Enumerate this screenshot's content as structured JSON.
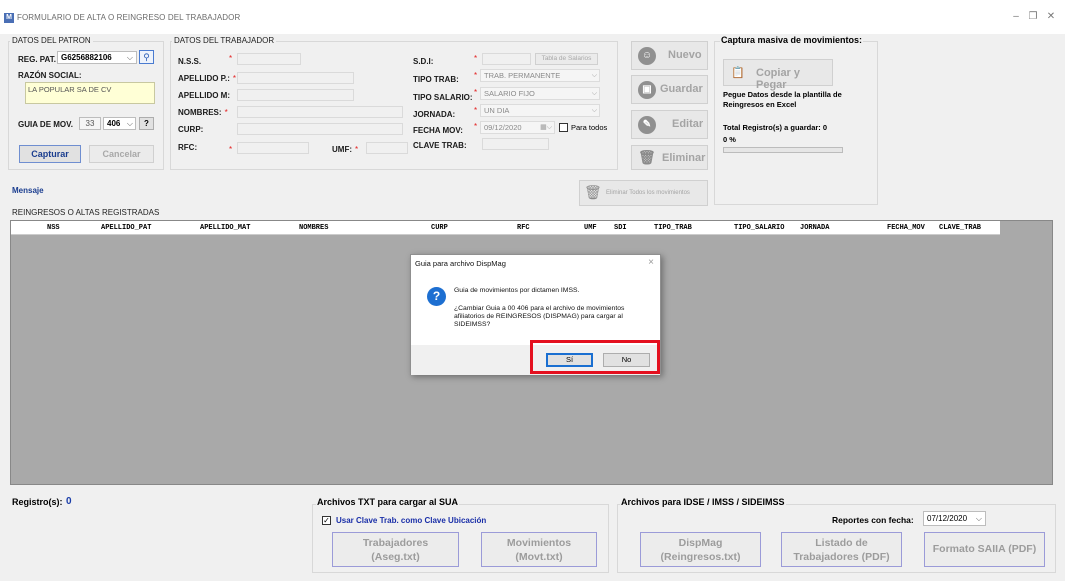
{
  "window": {
    "title": "FORMULARIO DE ALTA O REINGRESO DEL TRABAJADOR",
    "icon_letter": "M",
    "min": "–",
    "max": "❐",
    "close": "✕"
  },
  "patron": {
    "group_label": "DATOS DEL PATRON",
    "reg_pat_label": "REG. PAT.",
    "reg_pat_value": "G6256882106",
    "razon_label": "RAZÓN SOCIAL:",
    "razon_value": "LA POPULAR SA DE CV",
    "guia_label": "GUIA DE MOV.",
    "guia_num": "33",
    "guia_code": "406",
    "help": "?",
    "capturar": "Capturar",
    "cancelar": "Cancelar"
  },
  "trabajador": {
    "group_label": "DATOS DEL TRABAJADOR",
    "nss": "N.S.S.",
    "apellido_p": "APELLIDO P.:",
    "apellido_m": "APELLIDO M:",
    "nombres": "NOMBRES:",
    "curp": "CURP:",
    "rfc": "RFC:",
    "umf": "UMF:",
    "sdi": "S.D.I:",
    "tabla_salarios": "Tabla de Salarios",
    "tipo_trab": "TIPO TRAB:",
    "tipo_trab_value": "TRAB. PERMANENTE",
    "tipo_salario": "TIPO SALARIO:",
    "tipo_salario_value": "SALARIO FIJO",
    "jornada": "JORNADA:",
    "jornada_value": "UN DIA",
    "fecha_mov": "FECHA MOV:",
    "fecha_mov_value": "09/12/2020",
    "para_todos": "Para todos",
    "clave_trab": "CLAVE TRAB:",
    "req": "*"
  },
  "actions": {
    "nuevo": "Nuevo",
    "guardar": "Guardar",
    "editar": "Editar",
    "eliminar": "Eliminar",
    "eliminar_todos": "Eliminar Todos los movimientos"
  },
  "masiva": {
    "title": "Captura masiva de movimientos:",
    "copiar": "Copiar y Pegar",
    "hint": "Pegue Datos desde la plantilla de Reingresos en Excel",
    "total": "Total Registro(s) a guardar:  0",
    "percent": "0 %"
  },
  "mensaje": "Mensaje",
  "grid": {
    "label": "REINGRESOS O ALTAS REGISTRADAS",
    "columns": [
      "NSS",
      "APELLIDO_PAT",
      "APELLIDO_MAT",
      "NOMBRES",
      "CURP",
      "RFC",
      "UMF",
      "SDI",
      "TIPO_TRAB",
      "TIPO_SALARIO",
      "JORNADA",
      "FECHA_MOV",
      "CLAVE_TRAB"
    ]
  },
  "footer": {
    "registros_label": "Registro(s):",
    "registros_value": "0",
    "txt_group": "Archivos  TXT para cargar al SUA",
    "usar_clave": "Usar Clave Trab. como Clave Ubicación",
    "trabajadores": "Trabajadores",
    "trabajadores_sub": "(Aseg.txt)",
    "movimientos": "Movimientos",
    "movimientos_sub": "(Movt.txt)",
    "idse_group": "Archivos para IDSE / IMSS / SIDEIMSS",
    "reportes_label": "Reportes con fecha:",
    "reportes_fecha": "07/12/2020",
    "dispmag": "DispMag",
    "dispmag_sub": "(Reingresos.txt)",
    "listado": "Listado de",
    "listado_sub": "Trabajadores (PDF)",
    "formato": "Formato SAIIA (PDF)"
  },
  "dialog": {
    "title": "Guia para archivo DispMag",
    "line1": "Guia de movimientos por dictamen IMSS.",
    "line2": "¿Cambiar Guia a 00 406 para el archivo de movimientos",
    "line3": "afiliatorios de REINGRESOS (DISPMAG) para cargar al",
    "line4": "SIDEIMSS?",
    "yes": "Sí",
    "no": "No"
  }
}
